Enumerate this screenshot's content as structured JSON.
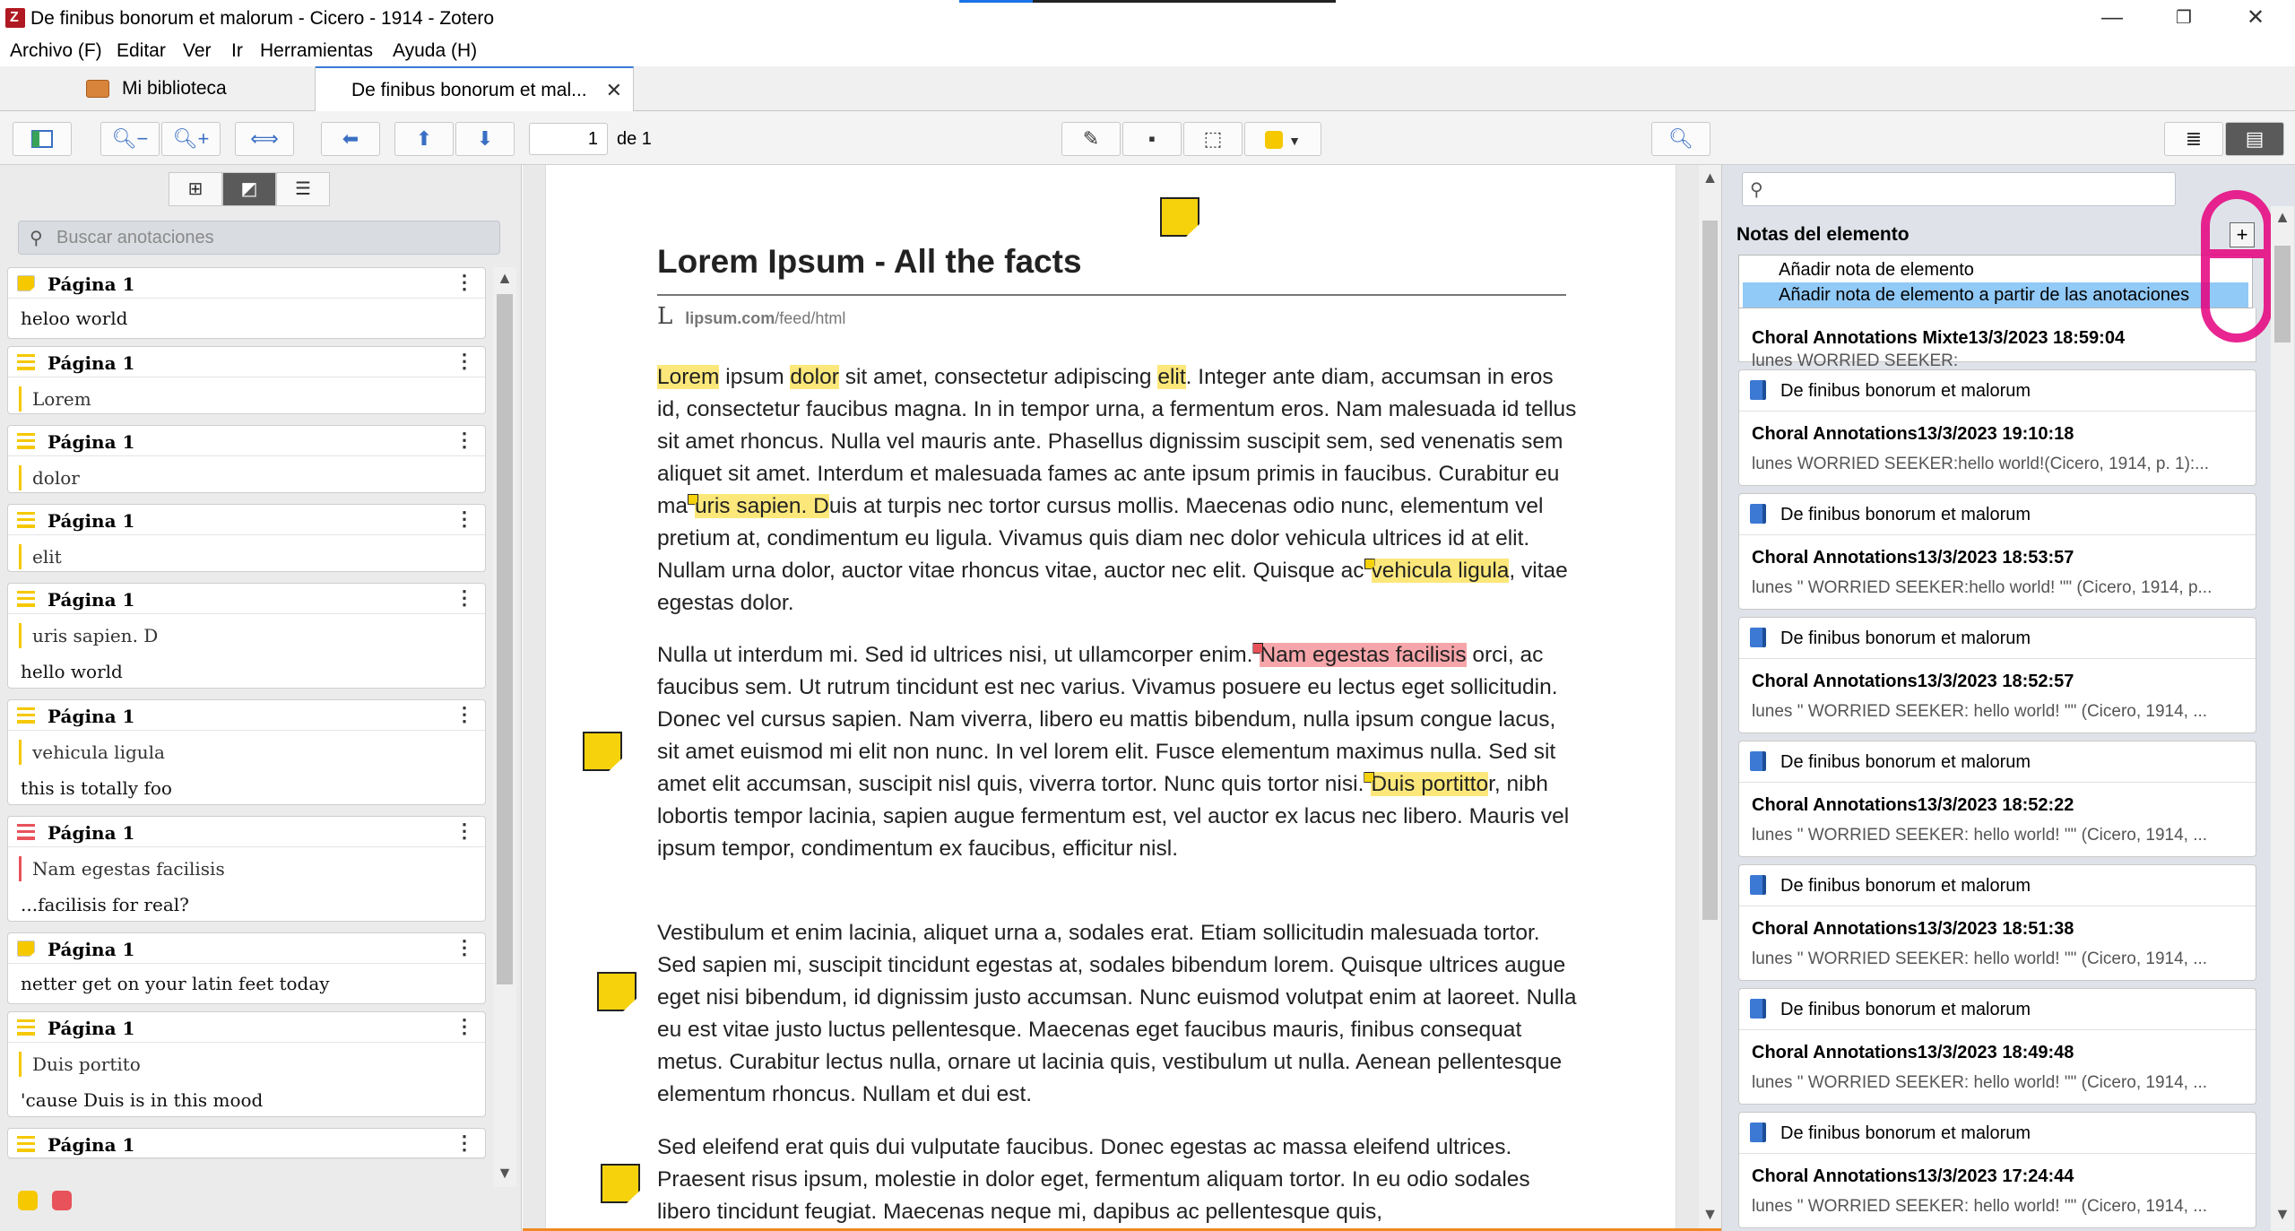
{
  "window": {
    "title": "De finibus bonorum et malorum - Cicero - 1914 - Zotero",
    "min": "—",
    "max": "❐",
    "close": "✕"
  },
  "menu": {
    "archivo": "Archivo (F)",
    "editar": "Editar",
    "ver": "Ver",
    "ir": "Ir",
    "herramientas": "Herramientas",
    "ayuda": "Ayuda (H)"
  },
  "tabs": {
    "library": "Mi biblioteca",
    "doc": "De finibus bonorum et mal...",
    "close": "✕"
  },
  "toolbar": {
    "page": "1",
    "of": "de 1",
    "highlight_color": "#f5c800"
  },
  "sidebar": {
    "search_placeholder": "Buscar anotaciones",
    "cards": [
      {
        "page": "Página 1",
        "type": "note",
        "quote": "",
        "comment": "heloo world"
      },
      {
        "page": "Página 1",
        "type": "highlight",
        "quote": "Lorem",
        "comment": ""
      },
      {
        "page": "Página 1",
        "type": "highlight",
        "quote": "dolor",
        "comment": ""
      },
      {
        "page": "Página 1",
        "type": "highlight",
        "quote": "elit",
        "comment": ""
      },
      {
        "page": "Página 1",
        "type": "highlight",
        "quote": "uris sapien. D",
        "comment": "hello world"
      },
      {
        "page": "Página 1",
        "type": "highlight",
        "quote": "vehicula ligula",
        "comment": "this is totally foo"
      },
      {
        "page": "Página 1",
        "type": "highlight-red",
        "quote": "Nam egestas facilisis",
        "comment": "...facilisis for real?"
      },
      {
        "page": "Página 1",
        "type": "note",
        "quote": "",
        "comment": "netter get on your latin feet today"
      },
      {
        "page": "Página 1",
        "type": "highlight",
        "quote": "Duis portito",
        "comment": "'cause Duis is in this mood"
      },
      {
        "page": "Página 1",
        "type": "highlight",
        "quote": "",
        "comment": ""
      }
    ],
    "filter_colors": [
      "#f5c800",
      "#e8525b"
    ]
  },
  "document": {
    "title": "Lorem Ipsum - All the facts",
    "source_letter": "L",
    "source_domain": "lipsum.com",
    "source_path": "/feed/html",
    "p1": {
      "a": "Lorem",
      "b": " ipsum ",
      "c": "dolor",
      "d": " sit amet, consectetur adipiscing ",
      "e": "elit",
      "f": ". Integer ante diam, accumsan in eros id, consectetur faucibus magna. In in tempor urna, a fermentum eros. Nam malesuada id tellus sit amet rhoncus. Nulla vel mauris ante. Phasellus dignissim suscipit sem, sed venenatis sem aliquet sit amet. Interdum et malesuada fames ac ante ipsum primis in faucibus. Curabitur eu ma",
      "g": "uris sapien. D",
      "h": "uis at turpis nec tortor cursus mollis. Maecenas odio nunc, elementum vel pretium at, condimentum eu ligula. Vivamus quis diam nec dolor vehicula ultrices id at elit. Nullam urna dolor, auctor vitae rhoncus vitae, auctor nec elit. Quisque ac",
      "i": "vehicula ligula",
      "j": ", vitae egestas dolor."
    },
    "p2": {
      "a": "Nulla ut interdum mi. Sed id ultrices nisi, ut ullamcorper enim.",
      "b": "Nam egestas facilisis",
      "c": " orci, ac faucibus sem. Ut rutrum tincidunt est nec varius. Vivamus posuere eu lectus eget sollicitudin. Donec vel cursus sapien. Nam viverra, libero eu mattis bibendum, nulla ipsum congue lacus, sit amet euismod mi elit non nunc. In vel lorem elit. Fusce elementum maximus nulla. Sed sit amet elit accumsan, suscipit nisl quis, viverra tortor. Nunc quis tortor nisi.",
      "d": "Duis portitto",
      "e": "r, nibh lobortis tempor lacinia, sapien augue fermentum est, vel auctor ex lacus nec libero. Mauris vel ipsum tempor, condimentum ex faucibus, efficitur nisl."
    },
    "p3": "Vestibulum et enim lacinia, aliquet urna a, sodales erat. Etiam sollicitudin malesuada tortor. Sed sapien mi, suscipit tincidunt egestas at, sodales bibendum lorem. Quisque ultrices augue eget nisi bibendum, id dignissim justo accumsan. Nunc euismod volutpat enim at laoreet. Nulla eu est vitae justo luctus pellentesque. Maecenas eget faucibus mauris, finibus consequat metus. Curabitur lectus nulla, ornare ut lacinia quis, vestibulum ut nulla. Aenean pellentesque elementum rhoncus. Nullam et dui est.",
    "p4": "Sed eleifend erat quis dui vulputate faucibus. Donec egestas ac massa eleifend ultrices. Praesent risus ipsum, molestie in dolor eget, fermentum aliquam tortor. In eu odio sodales libero tincidunt feugiat. Maecenas neque mi, dapibus ac pellentesque quis,"
  },
  "notes_pane": {
    "heading": "Notas del elemento",
    "add_symbol": "+",
    "menu": {
      "add_item_note": "Añadir nota de elemento",
      "add_from_annotations": "Añadir nota de elemento a partir de las anotaciones"
    },
    "first_note": {
      "title": "Choral Annotations Mixte13/3/2023 18:59:04",
      "preview": "lunes   WORRIED SEEKER:"
    },
    "notes": [
      {
        "parent": "De finibus bonorum et malorum",
        "title": "Choral Annotations13/3/2023 19:10:18",
        "preview": "lunes   WORRIED SEEKER:hello world!(Cicero, 1914, p. 1):..."
      },
      {
        "parent": "De finibus bonorum et malorum",
        "title": "Choral Annotations13/3/2023 18:53:57",
        "preview": "lunes   \" WORRIED SEEKER:hello world! \"\" (Cicero, 1914, p..."
      },
      {
        "parent": "De finibus bonorum et malorum",
        "title": "Choral Annotations13/3/2023 18:52:57",
        "preview": "lunes   \" WORRIED SEEKER: hello world! \"\" (Cicero, 1914, ..."
      },
      {
        "parent": "De finibus bonorum et malorum",
        "title": "Choral Annotations13/3/2023 18:52:22",
        "preview": "lunes   \" WORRIED SEEKER: hello world! \"\" (Cicero, 1914, ..."
      },
      {
        "parent": "De finibus bonorum et malorum",
        "title": "Choral Annotations13/3/2023 18:51:38",
        "preview": "lunes   \" WORRIED SEEKER: hello world! \"\" (Cicero, 1914, ..."
      },
      {
        "parent": "De finibus bonorum et malorum",
        "title": "Choral Annotations13/3/2023 18:49:48",
        "preview": "lunes   \" WORRIED SEEKER: hello world! \"\" (Cicero, 1914, ..."
      },
      {
        "parent": "De finibus bonorum et malorum",
        "title": "Choral Annotations13/3/2023 17:24:44",
        "preview": "lunes   \" WORRIED SEEKER: hello world! \"\" (Cicero, 1914, ..."
      }
    ]
  }
}
